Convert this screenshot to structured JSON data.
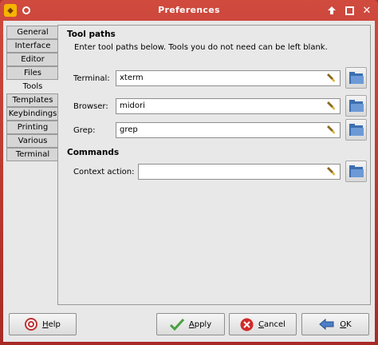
{
  "window": {
    "title": "Preferences"
  },
  "tabs": [
    {
      "label": "General",
      "active": false
    },
    {
      "label": "Interface",
      "active": false
    },
    {
      "label": "Editor",
      "active": false
    },
    {
      "label": "Files",
      "active": false
    },
    {
      "label": "Tools",
      "active": true
    },
    {
      "label": "Templates",
      "active": false
    },
    {
      "label": "Keybindings",
      "active": false
    },
    {
      "label": "Printing",
      "active": false
    },
    {
      "label": "Various",
      "active": false
    },
    {
      "label": "Terminal",
      "active": false
    }
  ],
  "tool_paths": {
    "heading": "Tool paths",
    "description": "Enter tool paths below. Tools you do not need can be left blank.",
    "terminal": {
      "label": "Terminal:",
      "value": "xterm"
    },
    "browser": {
      "label": "Browser:",
      "value": "midori"
    },
    "grep": {
      "label": "Grep:",
      "value": "grep"
    }
  },
  "commands": {
    "heading": "Commands",
    "context_action": {
      "label": "Context action:",
      "value": ""
    }
  },
  "buttons": {
    "help": {
      "mnemonic": "H",
      "rest": "elp"
    },
    "apply": {
      "mnemonic": "A",
      "rest": "pply"
    },
    "cancel": {
      "mnemonic": "C",
      "rest": "ancel"
    },
    "ok": {
      "mnemonic": "O",
      "rest": "K"
    }
  },
  "colors": {
    "titlebar": "#c03a33",
    "background": "#e8e8e8"
  },
  "icons": [
    "app-icon",
    "window-menu-icon",
    "shade-icon",
    "maximize-icon",
    "close-icon",
    "clear-entry-icon",
    "folder-open-icon",
    "help-icon",
    "apply-icon",
    "cancel-icon",
    "ok-icon"
  ]
}
